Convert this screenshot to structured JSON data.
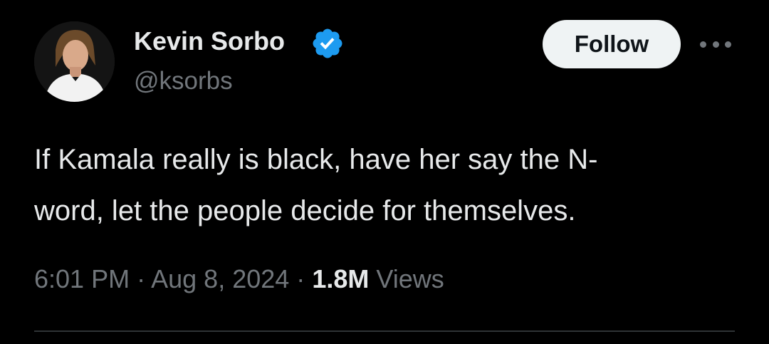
{
  "author": {
    "display_name": "Kevin Sorbo",
    "handle": "@ksorbs",
    "verified": true,
    "avatar_icon": "profile-photo"
  },
  "actions": {
    "follow_label": "Follow",
    "more_icon": "more-horizontal-icon"
  },
  "tweet": {
    "lines": [
      "If Kamala really is black, have her say the N-",
      "word, let the people decide for themselves."
    ]
  },
  "meta": {
    "time": "6:01 PM",
    "separator": "·",
    "date": "Aug 8, 2024",
    "views_count": "1.8M",
    "views_label": "Views"
  },
  "colors": {
    "background": "#000000",
    "text": "#e7e9ea",
    "secondary": "#71767b",
    "verified_badge": "#1d9bf0",
    "follow_bg": "#eff3f4",
    "divider": "#2f3336"
  }
}
